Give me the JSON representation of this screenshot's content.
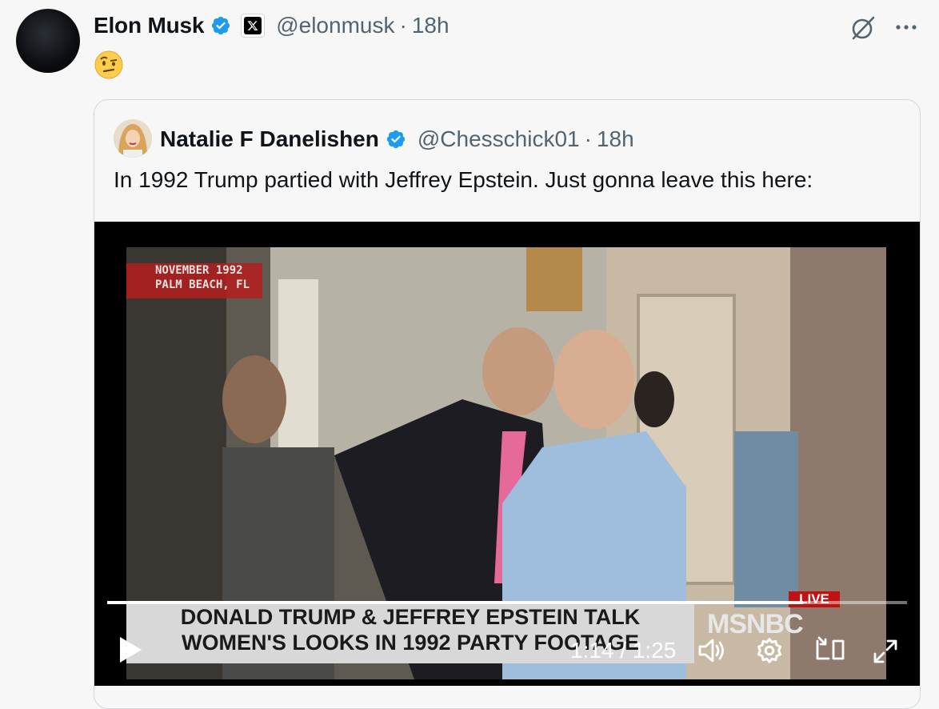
{
  "tweet": {
    "author_name": "Elon Musk",
    "author_handle": "@elonmusk",
    "separator": "·",
    "time": "18h",
    "emoji": "🤨"
  },
  "quote": {
    "author_name": "Natalie F Danelishen",
    "author_handle": "@Chesschick01",
    "separator": "·",
    "time": "18h",
    "text": "In 1992 Trump partied with Jeffrey Epstein. Just gonna leave this here:"
  },
  "video": {
    "overlay_date": "NOVEMBER 1992",
    "overlay_place": "PALM BEACH, FL",
    "chyron_line1": "DONALD TRUMP & JEFFREY EPSTEIN TALK",
    "chyron_line2": "WOMEN'S LOOKS IN 1992 PARTY FOOTAGE",
    "live_badge": "LIVE",
    "network": "MSNBC",
    "timecode": "1:14 / 1:25",
    "progress_fraction": 0.87
  },
  "colors": {
    "verified": "#1d9bf0",
    "secondary_text": "#536471",
    "border": "#cfd9de"
  },
  "icons": [
    "verified-badge-icon",
    "x-affiliate-icon",
    "grok-icon",
    "more-icon",
    "play-icon",
    "volume-icon",
    "settings-icon",
    "minimize-icon",
    "fullscreen-icon"
  ]
}
